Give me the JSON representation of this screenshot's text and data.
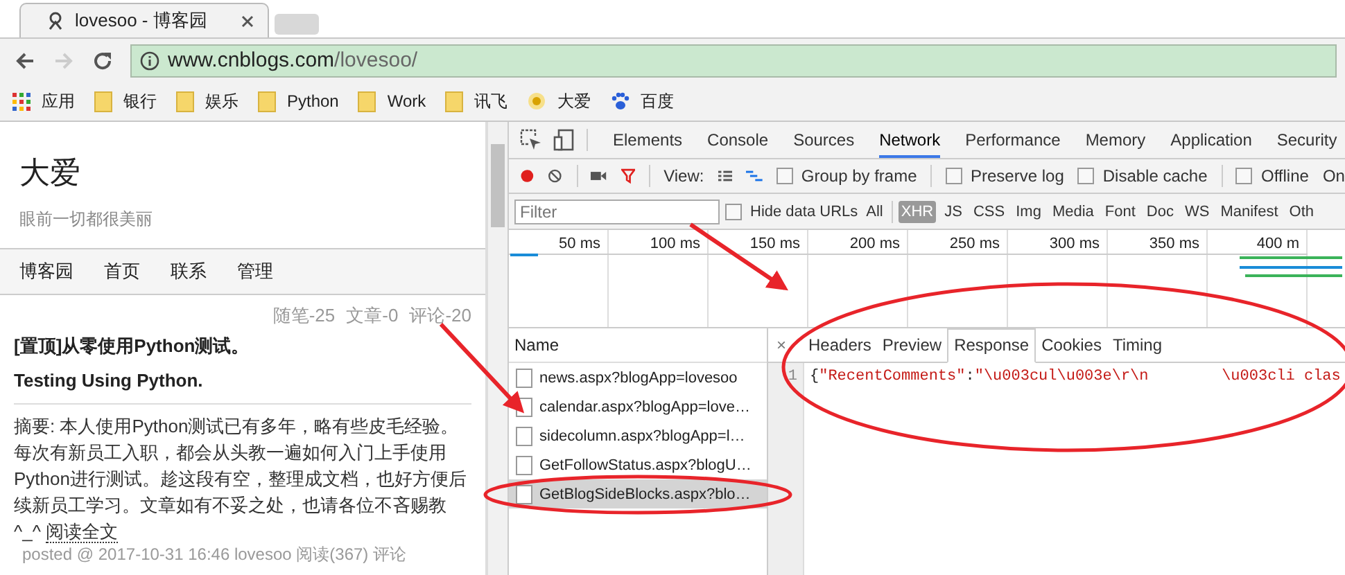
{
  "browser": {
    "tab_title": "lovesoo - 博客园",
    "url_host": "www.cnblogs.com",
    "url_path": "/lovesoo/"
  },
  "bookmarks": [
    {
      "kind": "apps",
      "label": "应用"
    },
    {
      "kind": "folder",
      "label": "银行"
    },
    {
      "kind": "folder",
      "label": "娱乐"
    },
    {
      "kind": "folder",
      "label": "Python"
    },
    {
      "kind": "folder",
      "label": "Work"
    },
    {
      "kind": "folder",
      "label": "讯飞"
    },
    {
      "kind": "site",
      "label": "大爱"
    },
    {
      "kind": "paw",
      "label": "百度"
    }
  ],
  "blog": {
    "title": "大爱",
    "subtitle": "眼前一切都很美丽",
    "nav": [
      "博客园",
      "首页",
      "联系",
      "管理"
    ],
    "stats": [
      "随笔-25",
      "文章-0",
      "评论-20"
    ],
    "post_title": "[置顶]从零使用Python测试。Testing Using Python.",
    "summary": "摘要: 本人使用Python测试已有多年，略有些皮毛经验。每次有新员工入职，都会从头教一遍如何入门上手使用Python进行测试。趁这段有空，整理成文档，也好方便后续新员工学习。文章如有不妥之处，也请各位不吝赐教^_^",
    "read_more": "阅读全文",
    "posted": "posted @ 2017-10-31 16:46 lovesoo 阅读(367) 评论"
  },
  "devtools": {
    "tabs": [
      {
        "label": "Elements",
        "selected": false
      },
      {
        "label": "Console",
        "selected": false
      },
      {
        "label": "Sources",
        "selected": false
      },
      {
        "label": "Network",
        "selected": true
      },
      {
        "label": "Performance",
        "selected": false
      },
      {
        "label": "Memory",
        "selected": false
      },
      {
        "label": "Application",
        "selected": false
      },
      {
        "label": "Security",
        "selected": false
      }
    ],
    "view_label": "View:",
    "options": [
      {
        "label": "Group by frame",
        "checked": false
      },
      {
        "label": "Preserve log",
        "checked": false
      },
      {
        "label": "Disable cache",
        "checked": false
      },
      {
        "label": "Offline",
        "checked": false
      }
    ],
    "online_label": "On",
    "filter": {
      "placeholder": "Filter"
    },
    "hide_data_urls": {
      "label": "Hide data URLs",
      "checked": false
    },
    "types": [
      {
        "label": "All",
        "selected": false
      },
      {
        "label": "XHR",
        "selected": true
      },
      {
        "label": "JS",
        "selected": false
      },
      {
        "label": "CSS",
        "selected": false
      },
      {
        "label": "Img",
        "selected": false
      },
      {
        "label": "Media",
        "selected": false
      },
      {
        "label": "Font",
        "selected": false
      },
      {
        "label": "Doc",
        "selected": false
      },
      {
        "label": "WS",
        "selected": false
      },
      {
        "label": "Manifest",
        "selected": false
      },
      {
        "label": "Oth",
        "selected": false
      }
    ],
    "timeline_ticks": [
      "50 ms",
      "100 ms",
      "150 ms",
      "200 ms",
      "250 ms",
      "300 ms",
      "350 ms",
      "400 m"
    ],
    "name_header": "Name",
    "requests": [
      {
        "name": "news.aspx?blogApp=lovesoo",
        "selected": false
      },
      {
        "name": "calendar.aspx?blogApp=love…",
        "selected": false
      },
      {
        "name": "sidecolumn.aspx?blogApp=l…",
        "selected": false
      },
      {
        "name": "GetFollowStatus.aspx?blogU…",
        "selected": false
      },
      {
        "name": "GetBlogSideBlocks.aspx?blo…",
        "selected": true
      }
    ],
    "close_label": "×",
    "detail_tabs": [
      {
        "label": "Headers",
        "selected": false
      },
      {
        "label": "Preview",
        "selected": false
      },
      {
        "label": "Response",
        "selected": true
      },
      {
        "label": "Cookies",
        "selected": false
      },
      {
        "label": "Timing",
        "selected": false
      }
    ],
    "response_lines": [
      {
        "number": "1",
        "brace": "{",
        "key": "\"RecentComments\"",
        "colon": ":",
        "value": "\"\\u003cul\\u003e\\r\\n        \\u003cli clas"
      }
    ]
  }
}
